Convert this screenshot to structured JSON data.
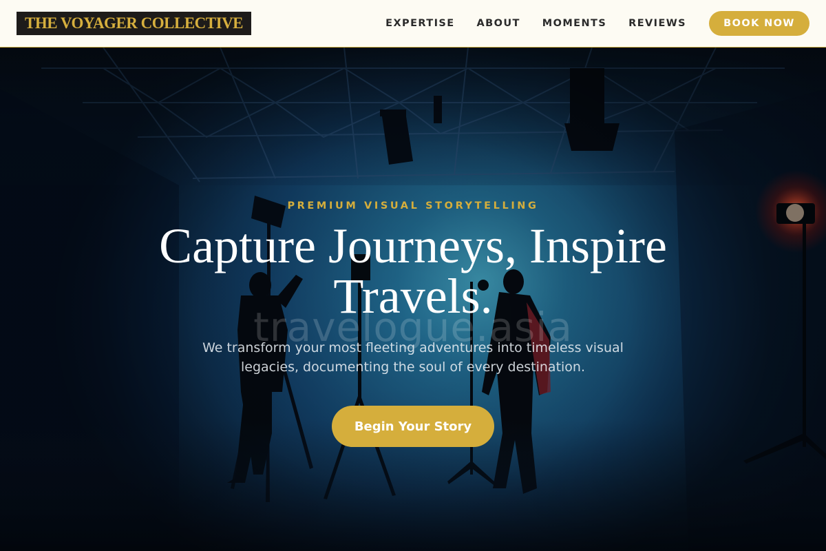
{
  "brand": {
    "logo_text": "THE VOYAGER COLLECTIVE"
  },
  "nav": {
    "links": [
      "EXPERTISE",
      "ABOUT",
      "MOMENTS",
      "REVIEWS"
    ],
    "cta_label": "BOOK NOW"
  },
  "hero": {
    "eyebrow": "PREMIUM VISUAL STORYTELLING",
    "headline_line1": "Capture Journeys, Inspire",
    "headline_line2": "Travels.",
    "watermark": "travelogue.asia",
    "subtext": "We transform your most fleeting adventures into timeless visual legacies, documenting the soul of every destination.",
    "cta_label": "Begin Your Story"
  },
  "colors": {
    "accent_gold": "#d5ae3c",
    "header_bg": "#fdfbf3",
    "logo_bg": "#1d1b1a",
    "hero_blue": "#123f66"
  }
}
